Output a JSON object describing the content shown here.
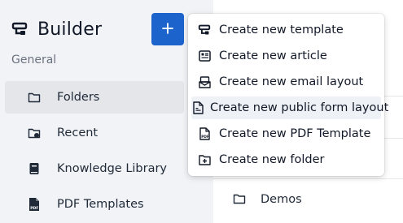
{
  "app": {
    "title": "Builder"
  },
  "sidebar": {
    "section_label": "General",
    "items": [
      {
        "label": "Folders",
        "icon": "folder-icon",
        "active": true
      },
      {
        "label": "Recent",
        "icon": "recent-folder-icon",
        "active": false
      },
      {
        "label": "Knowledge Library",
        "icon": "book-icon",
        "active": false
      },
      {
        "label": "PDF Templates",
        "icon": "pdf-file-icon",
        "active": false
      }
    ]
  },
  "add_button": {
    "icon": "plus-icon"
  },
  "menu": {
    "items": [
      {
        "label": "Create new template",
        "icon": "template-icon"
      },
      {
        "label": "Create new article",
        "icon": "article-icon"
      },
      {
        "label": "Create new email layout",
        "icon": "email-layout-icon"
      },
      {
        "label": "Create new public form layout",
        "icon": "form-file-icon",
        "highlighted": true
      },
      {
        "label": "Create new PDF Template",
        "icon": "pdf-file-icon"
      },
      {
        "label": "Create new folder",
        "icon": "add-folder-icon"
      }
    ]
  },
  "main": {
    "rows": [
      {
        "label": "Demos",
        "icon": "folder-icon"
      }
    ]
  },
  "colors": {
    "accent": "#1d63cc",
    "sidebar_bg": "#f1f3f6"
  }
}
